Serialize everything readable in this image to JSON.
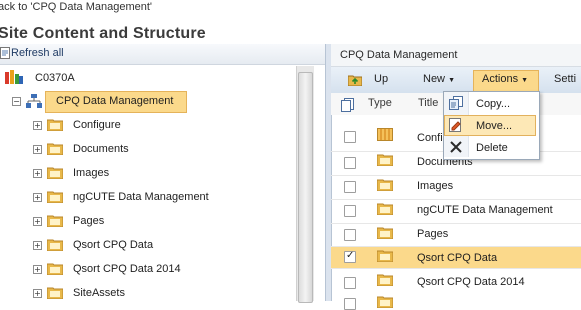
{
  "top": {
    "back_link": "ack to 'CPQ Data Management'",
    "page_title": "Site Content and Structure"
  },
  "left": {
    "refresh_label": "Refresh all",
    "root": "C0370A",
    "selected": "CPQ Data Management",
    "children": [
      "Configure",
      "Documents",
      "Images",
      "ngCUTE Data Management",
      "Pages",
      "Qsort CPQ Data",
      "Qsort CPQ Data 2014",
      "SiteAssets"
    ]
  },
  "right": {
    "title": "CPQ Data Management",
    "toolbar": {
      "up": "Up",
      "new": "New",
      "actions": "Actions",
      "settings": "Setti"
    },
    "columns": {
      "type": "Type",
      "title": "Title"
    },
    "rows": [
      {
        "title": "Confi",
        "checked": false
      },
      {
        "title": "Documents",
        "checked": false
      },
      {
        "title": "Images",
        "checked": false
      },
      {
        "title": "ngCUTE Data Management",
        "checked": false
      },
      {
        "title": "Pages",
        "checked": false
      },
      {
        "title": "Qsort CPQ Data",
        "checked": true
      },
      {
        "title": "Qsort CPQ Data 2014",
        "checked": false
      }
    ],
    "menu": {
      "copy": "Copy...",
      "move": "Move...",
      "delete": "Delete"
    }
  },
  "colors": {
    "highlight": "#fbd98b",
    "toolbar": "#dfe8f2",
    "folder": "#e8b84a"
  }
}
